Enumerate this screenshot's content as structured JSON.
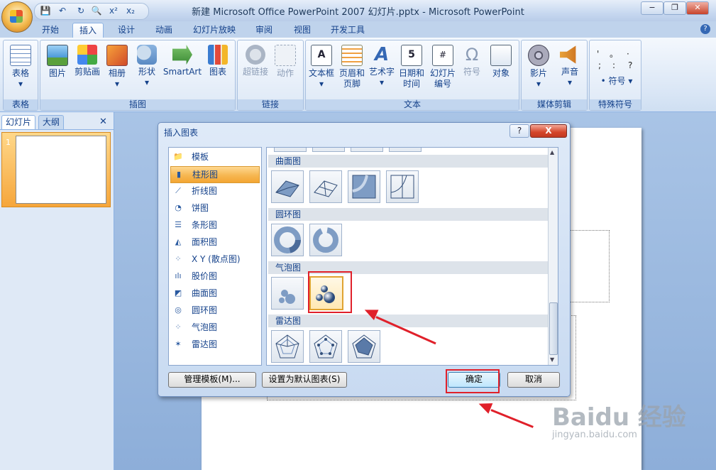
{
  "window": {
    "title": "新建 Microsoft Office PowerPoint 2007 幻灯片.pptx - Microsoft PowerPoint",
    "minimize": "−",
    "restore": "❐",
    "close": "✕"
  },
  "qat": [
    "save-icon",
    "undo-icon",
    "redo-icon",
    "print-preview-icon",
    "superscript-icon",
    "subscript-icon"
  ],
  "qat_glyphs": [
    "💾",
    "↶",
    "↻",
    "🔍",
    "x²",
    "x₂"
  ],
  "tabs": [
    "开始",
    "插入",
    "设计",
    "动画",
    "幻灯片放映",
    "审阅",
    "视图",
    "开发工具"
  ],
  "active_tab": "插入",
  "ribbon": {
    "groups": {
      "table": "表格",
      "illustrations": "插图",
      "links": "链接",
      "text": "文本",
      "media": "媒体剪辑",
      "symbols": "特殊符号"
    },
    "buttons": {
      "table": "表格",
      "picture": "图片",
      "clipart": "剪贴画",
      "album": "相册",
      "shapes": "形状",
      "smartart": "SmartArt",
      "chart": "图表",
      "hyperlink": "超链接",
      "action": "动作",
      "textbox": "文本框",
      "header_footer_1": "页眉和",
      "header_footer_2": "页脚",
      "wordart": "艺术字",
      "datetime_1": "日期和",
      "datetime_2": "时间",
      "slide_number_1": "幻灯片",
      "slide_number_2": "编号",
      "symbol": "符号",
      "object": "对象",
      "movie": "影片",
      "sound": "声音",
      "symbols_btn": "符号"
    },
    "dropdown_arrow": "▾",
    "symbol_marks": [
      "'",
      "。",
      "·",
      ";",
      ":",
      "?"
    ]
  },
  "left_panel": {
    "tabs": [
      "幻灯片",
      "大纲"
    ],
    "close": "✕",
    "slide_number": "1"
  },
  "dialog": {
    "title": "插入图表",
    "help": "?",
    "close": "X",
    "chart_types": [
      "模板",
      "柱形图",
      "折线图",
      "饼图",
      "条形图",
      "面积图",
      "X Y (散点图)",
      "股价图",
      "曲面图",
      "圆环图",
      "气泡图",
      "雷达图"
    ],
    "type_glyphs": [
      "📁",
      "▮",
      "⟋",
      "◔",
      "☰",
      "◭",
      "⁘",
      "ılı",
      "◩",
      "◎",
      "⁘",
      "✶"
    ],
    "selected_type": "柱形图",
    "sections": [
      "曲面图",
      "圆环图",
      "气泡图",
      "雷达图"
    ],
    "buttons": {
      "manage": "管理模板(M)...",
      "set_default": "设置为默认图表(S)",
      "ok": "确定",
      "cancel": "取消"
    }
  },
  "watermark": {
    "line1": "Baidu 经验",
    "line2": "jingyan.baidu.com"
  }
}
